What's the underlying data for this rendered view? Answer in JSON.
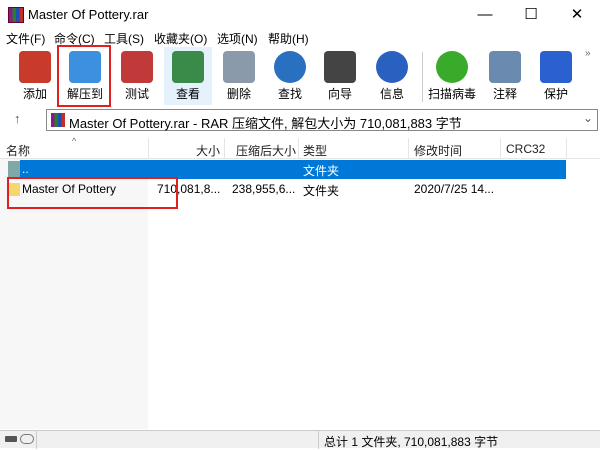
{
  "window": {
    "title": "Master Of Pottery.rar",
    "minimize": "—",
    "maximize": "☐",
    "close": "✕"
  },
  "menu": [
    "文件(F)",
    "命令(C)",
    "工具(S)",
    "收藏夹(O)",
    "选项(N)",
    "帮助(H)"
  ],
  "toolbar": [
    {
      "label": "添加",
      "icon": "add-archive-icon",
      "color": "#c83a2a"
    },
    {
      "label": "解压到",
      "icon": "extract-folder-icon",
      "color": "#3d8fe0"
    },
    {
      "label": "测试",
      "icon": "test-clipboard-icon",
      "color": "#c03a3a"
    },
    {
      "label": "查看",
      "icon": "view-book-icon",
      "color": "#3a8a4a"
    },
    {
      "label": "删除",
      "icon": "trash-icon",
      "color": "#8a9aaa"
    },
    {
      "label": "查找",
      "icon": "magnifier-icon",
      "color": "#2a70c0"
    },
    {
      "label": "向导",
      "icon": "wizard-wand-icon",
      "color": "#444"
    },
    {
      "label": "信息",
      "icon": "info-icon",
      "color": "#2a60c0"
    },
    {
      "label": "扫描病毒",
      "icon": "virus-scan-icon",
      "color": "#3aaa2a"
    },
    {
      "label": "注释",
      "icon": "comment-icon",
      "color": "#6a8ab0"
    },
    {
      "label": "保护",
      "icon": "shield-icon",
      "color": "#2a60d0"
    }
  ],
  "more": "»",
  "address": {
    "up": "↑",
    "text": "Master Of Pottery.rar - RAR 压缩文件, 解包大小为 710,081,883 字节",
    "dropdown": "⌄"
  },
  "columns": [
    "名称",
    "大小",
    "压缩后大小",
    "类型",
    "修改时间",
    "CRC32"
  ],
  "sort_indicator": "^",
  "rows": [
    {
      "name": "..",
      "size": "",
      "packed": "",
      "type": "文件夹",
      "modified": "",
      "crc": ""
    },
    {
      "name": "Master Of Pottery",
      "size": "710,081,8...",
      "packed": "238,955,6...",
      "type": "文件夹",
      "modified": "2020/7/25 14...",
      "crc": ""
    }
  ],
  "status": "总计 1 文件夹, 710,081,883 字节",
  "colors": {
    "selection": "#0078d7",
    "highlight": "#e02020"
  }
}
